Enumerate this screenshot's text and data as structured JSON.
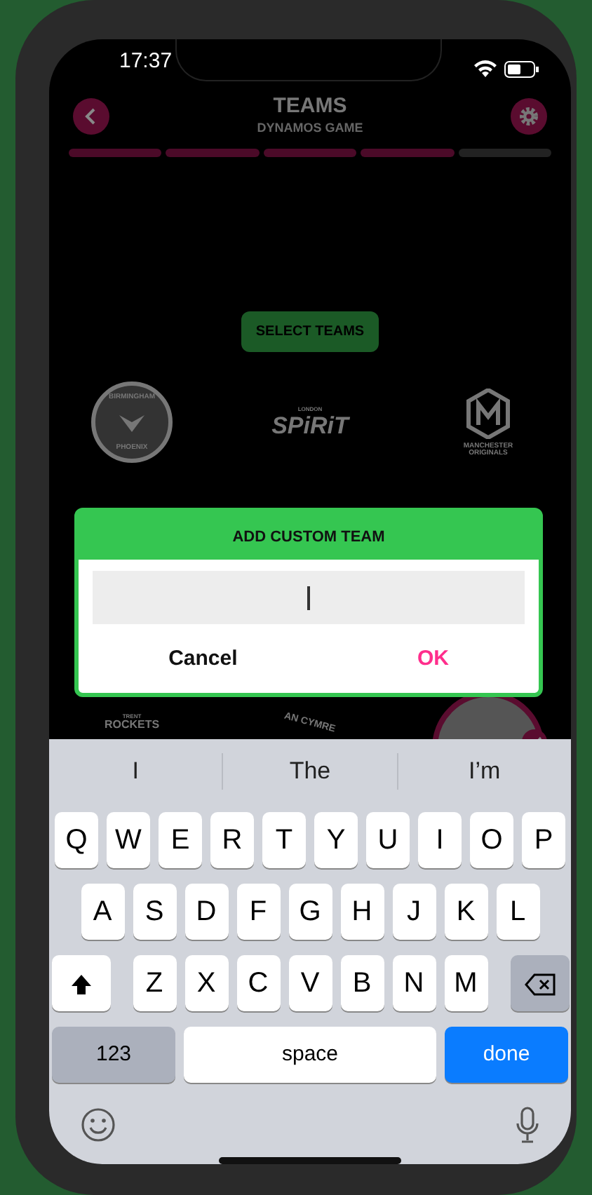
{
  "status_bar": {
    "time": "17:37"
  },
  "header": {
    "title": "TEAMS",
    "subtitle": "DYNAMOS GAME"
  },
  "progress_steps": [
    {
      "done": true
    },
    {
      "done": true
    },
    {
      "done": true
    },
    {
      "done": true
    },
    {
      "done": false
    }
  ],
  "select_button": "SELECT TEAMS",
  "teams": [
    {
      "kind": "badge",
      "lines": [
        "BIRMINGHAM",
        "PHOENIX"
      ]
    },
    {
      "kind": "wordmark",
      "lines": [
        "LONDON",
        "SPiRiT"
      ]
    },
    {
      "kind": "hexagon",
      "lines": [
        "MANCHESTER",
        "ORIGINALS"
      ]
    },
    {
      "kind": "wordmark",
      "lines": [
        "TRENT",
        "ROCKETS"
      ]
    },
    {
      "kind": "arc",
      "lines": [
        "AN CYMRE"
      ]
    },
    {
      "kind": "circle",
      "selected": true
    }
  ],
  "dialog": {
    "title": "ADD CUSTOM TEAM",
    "cancel": "Cancel",
    "ok": "OK"
  },
  "keyboard": {
    "suggestions": [
      "I",
      "The",
      "I’m"
    ],
    "rows": [
      [
        "Q",
        "W",
        "E",
        "R",
        "T",
        "Y",
        "U",
        "I",
        "O",
        "P"
      ],
      [
        "A",
        "S",
        "D",
        "F",
        "G",
        "H",
        "J",
        "K",
        "L"
      ],
      [
        "Z",
        "X",
        "C",
        "V",
        "B",
        "N",
        "M"
      ]
    ],
    "numbers": "123",
    "space": "space",
    "done": "done"
  }
}
